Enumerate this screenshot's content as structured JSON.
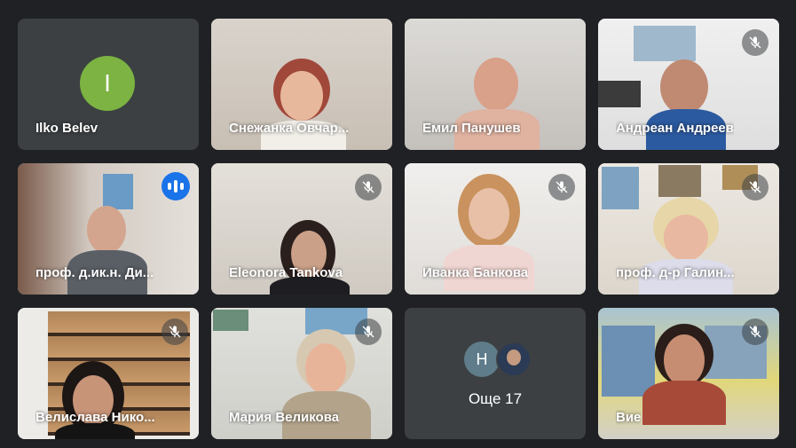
{
  "colors": {
    "background": "#202124",
    "tile": "#3c4043",
    "active_outline": "#8ab4f8",
    "speaking": "#1a73e8",
    "avatar_green": "#7cb342",
    "avatar_slate": "#5f7c8a"
  },
  "participants": [
    {
      "name": "Ilko Belev",
      "avatar_letter": "I",
      "camera": "off",
      "muted": false
    },
    {
      "name": "Снежанка Овчар...",
      "camera": "on",
      "muted": false
    },
    {
      "name": "Емил Панушев",
      "camera": "on",
      "muted": false
    },
    {
      "name": "Андреан Андреев",
      "camera": "on",
      "muted": true,
      "icon": "mic-off-icon"
    },
    {
      "name": "проф. д.ик.н. Ди...",
      "camera": "on",
      "muted": false,
      "speaking": true,
      "icon": "speaking-indicator-icon"
    },
    {
      "name": "Eleonora Tankova",
      "camera": "on",
      "muted": true,
      "icon": "mic-off-icon"
    },
    {
      "name": "Иванка Банкова",
      "camera": "on",
      "muted": true,
      "icon": "mic-off-icon"
    },
    {
      "name": "проф. д-р Галин...",
      "camera": "on",
      "muted": true,
      "icon": "mic-off-icon"
    },
    {
      "name": "Велислава Нико...",
      "camera": "on",
      "muted": true,
      "icon": "mic-off-icon"
    },
    {
      "name": "Мария Великова",
      "camera": "on",
      "muted": true,
      "icon": "mic-off-icon"
    },
    {
      "name": "Вие",
      "camera": "on",
      "muted": true,
      "icon": "mic-off-icon"
    }
  ],
  "overflow": {
    "label": "Още 17",
    "avatar_letter": "H"
  }
}
